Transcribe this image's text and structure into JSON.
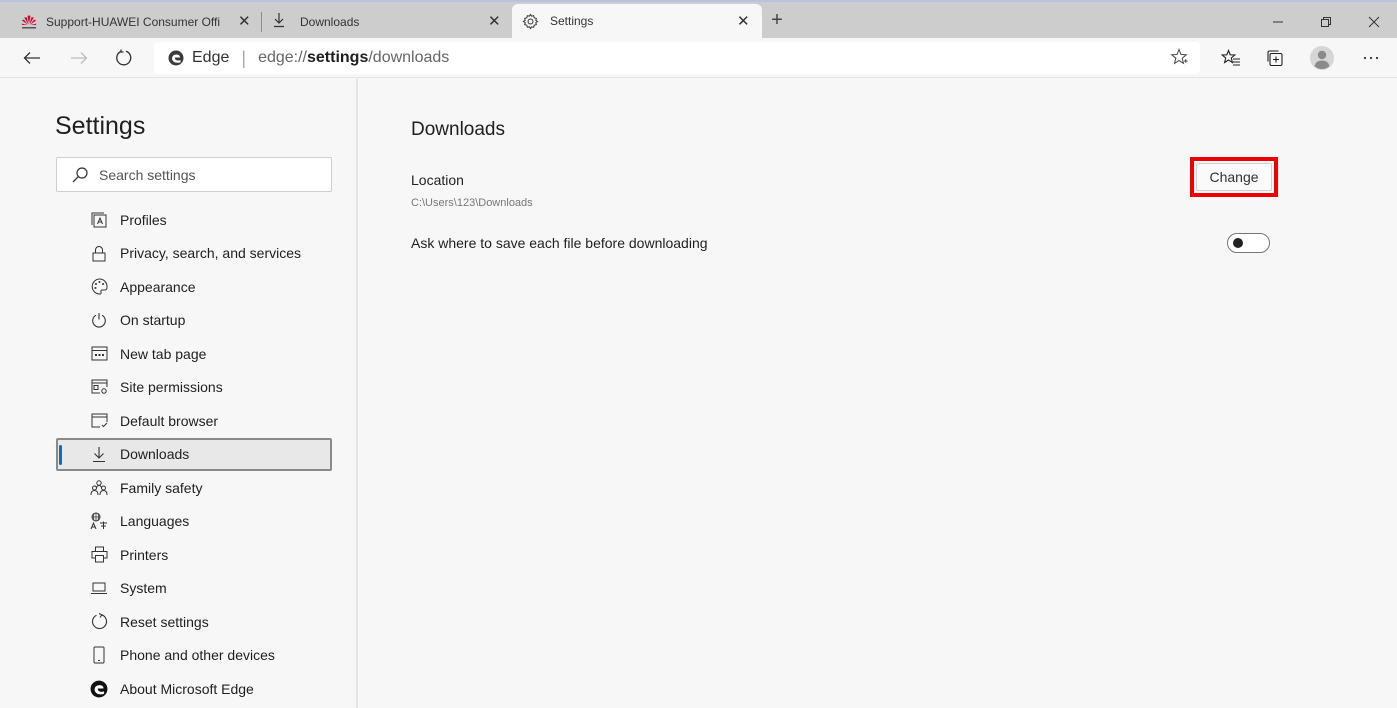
{
  "browser": {
    "tabs": [
      {
        "title": "Support-HUAWEI Consumer Offi",
        "icon": "huawei-logo-icon",
        "active": false
      },
      {
        "title": "Downloads",
        "icon": "download-icon",
        "active": false
      },
      {
        "title": "Settings",
        "icon": "gear-icon",
        "active": true
      }
    ],
    "new_tab_label": "+",
    "close_glyph": "✕",
    "window_controls": {
      "minimize": "—",
      "restore": "❐",
      "close": "✕"
    },
    "address_bar": {
      "site_label": "Edge",
      "url_prefix": "edge://",
      "url_bold": "settings",
      "url_suffix": "/downloads"
    },
    "toolbar_icons": [
      "favorites-icon",
      "collections-icon",
      "profile-avatar-icon",
      "more-menu-icon"
    ]
  },
  "sidebar": {
    "title": "Settings",
    "search_placeholder": "Search settings",
    "items": [
      {
        "label": "Profiles",
        "icon": "profile-card-icon"
      },
      {
        "label": "Privacy, search, and services",
        "icon": "lock-icon"
      },
      {
        "label": "Appearance",
        "icon": "palette-icon"
      },
      {
        "label": "On startup",
        "icon": "power-icon"
      },
      {
        "label": "New tab page",
        "icon": "new-tab-page-icon"
      },
      {
        "label": "Site permissions",
        "icon": "site-permissions-icon"
      },
      {
        "label": "Default browser",
        "icon": "default-browser-icon"
      },
      {
        "label": "Downloads",
        "icon": "download-icon",
        "active": true
      },
      {
        "label": "Family safety",
        "icon": "family-icon"
      },
      {
        "label": "Languages",
        "icon": "languages-icon"
      },
      {
        "label": "Printers",
        "icon": "printer-icon"
      },
      {
        "label": "System",
        "icon": "laptop-icon"
      },
      {
        "label": "Reset settings",
        "icon": "reset-icon"
      },
      {
        "label": "Phone and other devices",
        "icon": "phone-icon"
      },
      {
        "label": "About Microsoft Edge",
        "icon": "edge-logo-icon"
      }
    ]
  },
  "main": {
    "heading": "Downloads",
    "location_label": "Location",
    "location_path": "C:\\Users\\123\\Downloads",
    "change_button": "Change",
    "ask_label": "Ask where to save each file before downloading",
    "ask_toggle_on": false
  },
  "colors": {
    "accent": "#0f6cbd",
    "highlight_box": "#ee0000",
    "huawei_red": "#cf0a2c"
  }
}
